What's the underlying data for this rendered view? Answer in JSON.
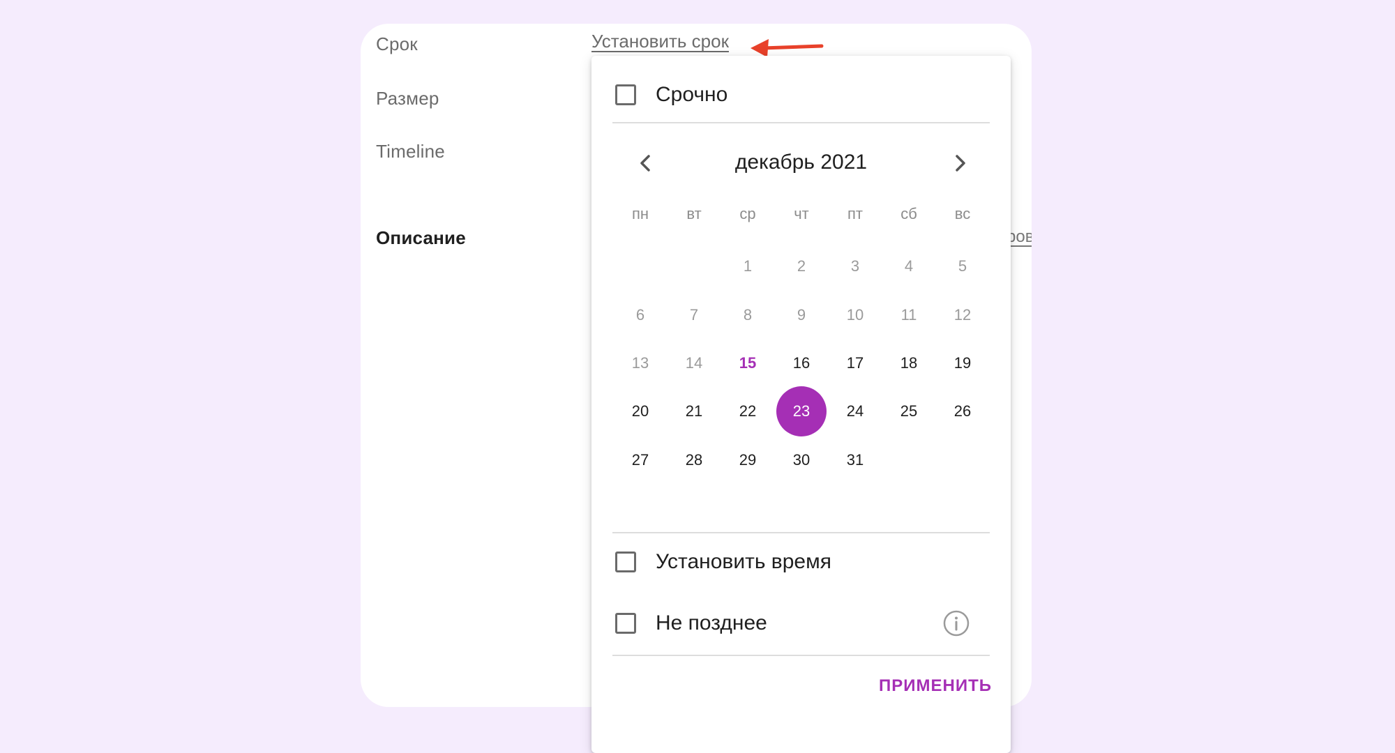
{
  "fields": {
    "deadline": "Срок",
    "size": "Размер",
    "timeline": "Timeline",
    "description": "Описание",
    "set_deadline_link": "Установить срок",
    "right_link_fragment": "ров"
  },
  "popup": {
    "urgent_label": "Срочно",
    "month_title": "декабрь 2021",
    "weekdays": [
      "пн",
      "вт",
      "ср",
      "чт",
      "пт",
      "сб",
      "вс"
    ],
    "weeks": [
      [
        "",
        "",
        "1",
        "2",
        "3",
        "4",
        "5"
      ],
      [
        "6",
        "7",
        "8",
        "9",
        "10",
        "11",
        "12"
      ],
      [
        "13",
        "14",
        "15",
        "16",
        "17",
        "18",
        "19"
      ],
      [
        "20",
        "21",
        "22",
        "23",
        "24",
        "25",
        "26"
      ],
      [
        "27",
        "28",
        "29",
        "30",
        "31",
        "",
        ""
      ]
    ],
    "today": "15",
    "selected": "23",
    "set_time_label": "Установить время",
    "not_later_label": "Не позднее",
    "apply_label": "ПРИМЕНИТЬ"
  },
  "colors": {
    "background": "#f5ecfd",
    "accent": "#a52fb5",
    "arrow": "#e8412a"
  },
  "icons": {
    "prev": "chevron-left-icon",
    "next": "chevron-right-icon",
    "info": "info-icon",
    "annotation": "arrow-left-icon"
  }
}
